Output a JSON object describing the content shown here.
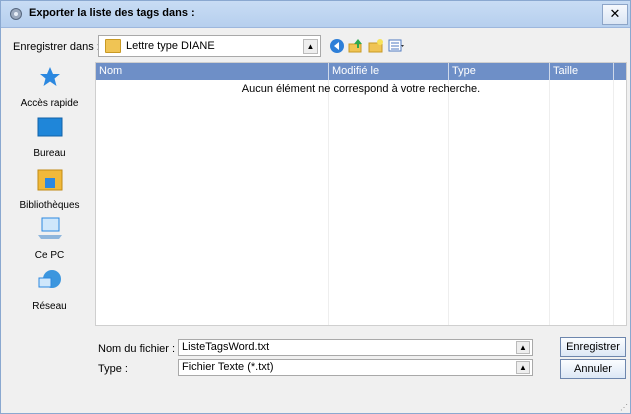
{
  "dialog": {
    "title": "Exporter la liste des tags dans :",
    "close_label": "✕"
  },
  "save_in": {
    "label": "Enregistrer dans :",
    "value": "Lettre type DIANE"
  },
  "toolbar": {
    "icons": [
      "back-icon",
      "up-folder-icon",
      "new-folder-icon",
      "view-menu-icon"
    ]
  },
  "places": [
    {
      "label": "Accès rapide",
      "icon": "star-icon"
    },
    {
      "label": "Bureau",
      "icon": "desktop-icon"
    },
    {
      "label": "Bibliothèques",
      "icon": "libraries-icon"
    },
    {
      "label": "Ce PC",
      "icon": "computer-icon"
    },
    {
      "label": "Réseau",
      "icon": "network-icon"
    }
  ],
  "file_list": {
    "columns": [
      "Nom",
      "Modifié le",
      "Type",
      "Taille"
    ],
    "empty_message": "Aucun élément ne correspond à votre recherche."
  },
  "filename": {
    "label": "Nom du fichier :",
    "value": "ListeTagsWord.txt"
  },
  "filetype": {
    "label": "Type :",
    "value": "Fichier Texte (*.txt)"
  },
  "buttons": {
    "save": "Enregistrer",
    "cancel": "Annuler"
  },
  "colors": {
    "header_bg": "#6e8fc7",
    "title_bg": "#c8dcf4"
  }
}
